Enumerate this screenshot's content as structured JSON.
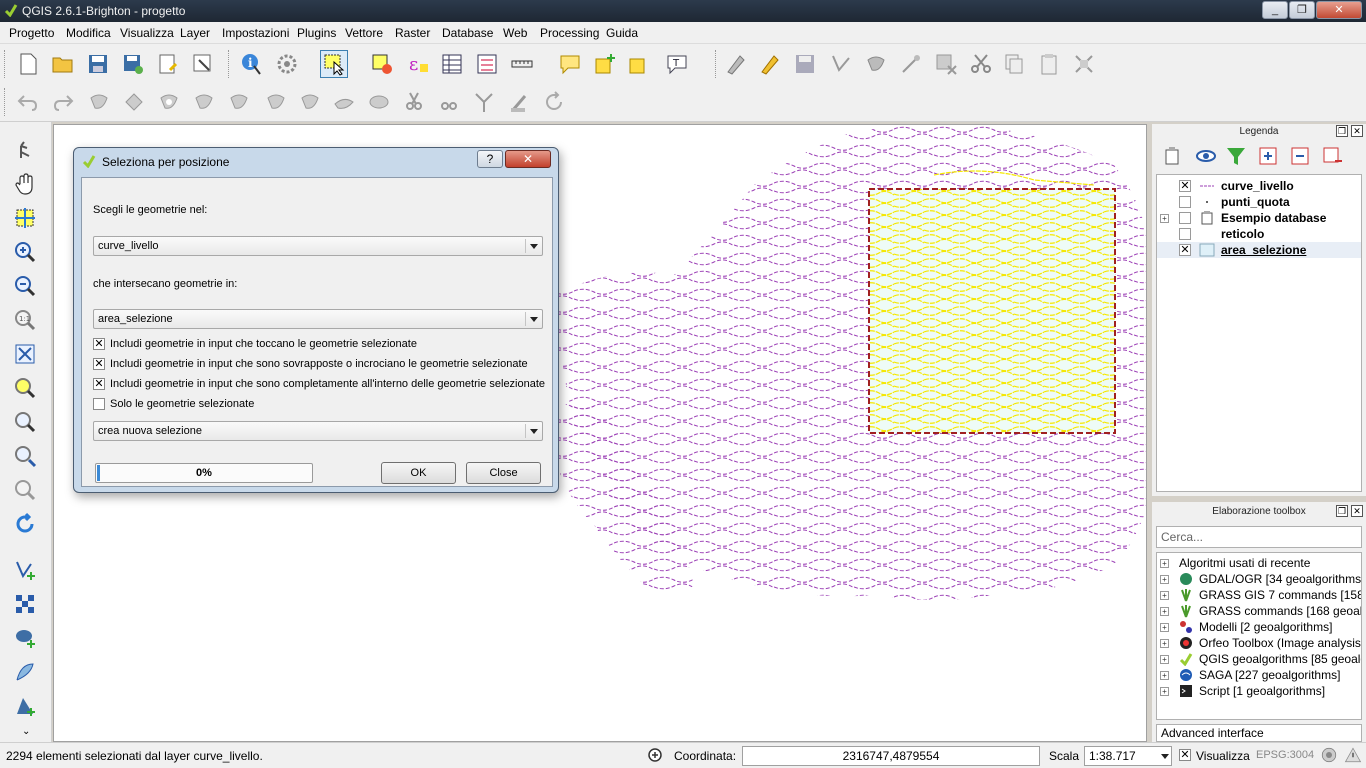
{
  "window": {
    "title": "QGIS 2.6.1-Brighton - progetto",
    "buttons": [
      "_",
      "❐",
      "✕"
    ]
  },
  "menu": [
    "Progetto",
    "Modifica",
    "Visualizza",
    "Layer",
    "Impostazioni",
    "Plugins",
    "Vettore",
    "Raster",
    "Database",
    "Web",
    "Processing",
    "Guida"
  ],
  "legend": {
    "title": "Legenda",
    "layers": [
      {
        "name": "curve_livello",
        "checked": true
      },
      {
        "name": "punti_quota",
        "checked": false
      },
      {
        "name": "Esempio database",
        "checked": false,
        "group": true
      },
      {
        "name": "reticolo",
        "checked": false
      },
      {
        "name": "area_selezione",
        "checked": true
      }
    ],
    "colors": {
      "contours": "#9b3fb5",
      "selected": "#ffff00",
      "selection_box": "#a02020"
    }
  },
  "processing": {
    "title": "Elaborazione toolbox",
    "search_placeholder": "Cerca...",
    "items": [
      "Algoritmi usati di recente",
      "GDAL/OGR [34 geoalgorithms]",
      "GRASS GIS 7 commands [158 g...",
      "GRASS commands [168 geoalgo...",
      "Modelli [2 geoalgorithms]",
      "Orfeo Toolbox (Image analysis)...",
      "QGIS geoalgorithms [85 geoalg...",
      "SAGA [227 geoalgorithms]",
      "Script [1 geoalgorithms]"
    ],
    "interface": "Advanced interface"
  },
  "dialog": {
    "title": "Seleziona per posizione",
    "help_label": "?",
    "close_label": "✕",
    "label_select": "Scegli le geometrie nel:",
    "layer_select": "curve_livello",
    "label_intersect": "che intersecano geometrie in:",
    "layer_intersect": "area_selezione",
    "options": [
      {
        "label": "Includi geometrie in input che toccano le geometrie selezionate",
        "checked": true
      },
      {
        "label": "Includi geometrie in input che sono sovrapposte o incrociano le geometrie selezionate",
        "checked": true
      },
      {
        "label": "Includi geometrie in input che sono completamente all'interno delle geometrie selezionate",
        "checked": true
      },
      {
        "label": "Solo le geometrie selezionate",
        "checked": false
      }
    ],
    "mode": "crea nuova selezione",
    "progress_text": "0%",
    "progress": 0,
    "ok_label": "OK",
    "close_button_label": "Close"
  },
  "status": {
    "message": "2294 elementi selezionati dal layer curve_livello.",
    "coord_label": "Coordinata:",
    "coord_value": "2316747,4879554",
    "scale_label": "Scala",
    "scale_value": "1:38.717",
    "render_label": "Visualizza",
    "crs": "EPSG:3004"
  }
}
